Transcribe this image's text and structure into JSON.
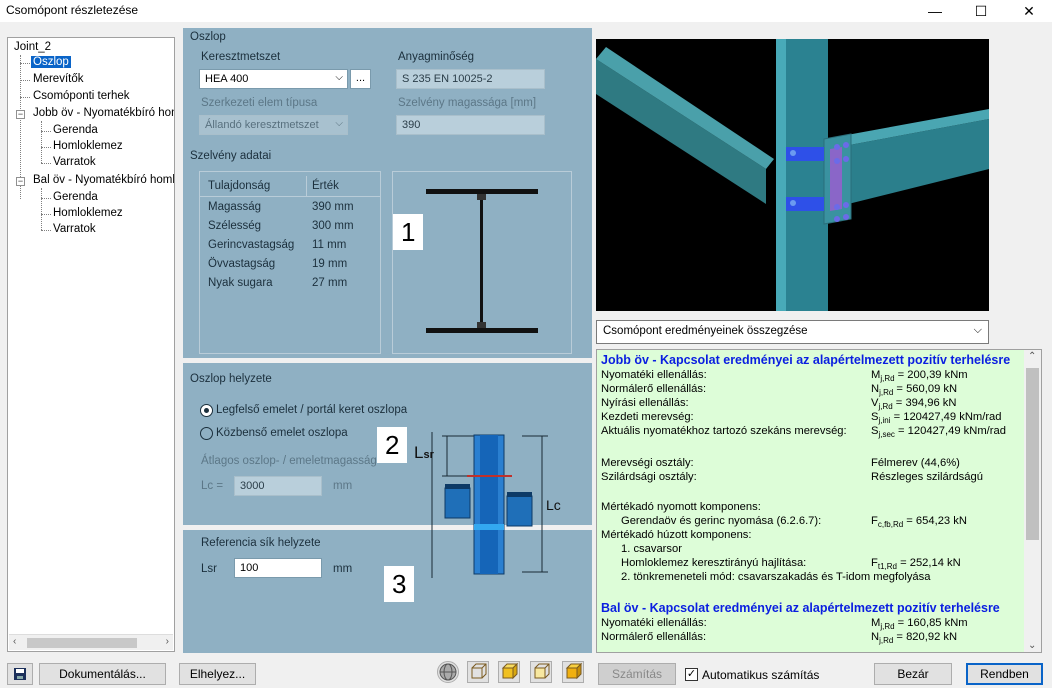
{
  "window": {
    "title": "Csomópont részletezése",
    "minimize": "—",
    "maximize": "☐",
    "close": "✕"
  },
  "tree": {
    "root": "Joint_2",
    "items": [
      "Oszlop",
      "Merevítők",
      "Csomóponti terhek",
      "Jobb öv - Nyomatékbíró homl",
      "Gerenda",
      "Homloklemez",
      "Varratok",
      "Bal öv - Nyomatékbíró homlc",
      "Gerenda",
      "Homloklemez",
      "Varratok"
    ],
    "selected": "Oszlop"
  },
  "oszlop": {
    "group_label": "Oszlop",
    "cross_section_label": "Keresztmetszet",
    "cross_section_value": "HEA 400",
    "browse_label": "...",
    "material_label": "Anyagminőség",
    "material_value": "S 235 EN 10025-2",
    "element_type_label": "Szerkezeti elem típusa",
    "element_type_value": "Állandó keresztmetszet",
    "height_label": "Szelvény magassága [mm]",
    "height_value": "390"
  },
  "section_data": {
    "group_label": "Szelvény adatai",
    "col_property": "Tulajdonság",
    "col_value": "Érték",
    "rows": [
      {
        "name": "Magasság",
        "value": "390 mm"
      },
      {
        "name": "Szélesség",
        "value": "300 mm"
      },
      {
        "name": "Gerincvastagság",
        "value": "11 mm"
      },
      {
        "name": "Övvastagság",
        "value": "19 mm"
      },
      {
        "name": "Nyak sugara",
        "value": "27 mm"
      }
    ]
  },
  "position": {
    "group_label": "Oszlop helyzete",
    "radio_top": "Legfelső emelet / portál keret oszlopa",
    "radio_mid": "Közbenső emelet oszlopa",
    "avg_height_label": "Átlagos oszlop- / emeletmagasság",
    "lc_label": "Lc =",
    "lc_value": "3000",
    "lc_unit": "mm",
    "lsr_diagram_label": "L",
    "lsr_diagram_sub": "sr",
    "lc_diagram_label": "Lc"
  },
  "reference": {
    "group_label": "Referencia sík helyzete",
    "lsr_label": "Lsr",
    "lsr_value": "100",
    "lsr_unit": "mm"
  },
  "markers": [
    "1",
    "2",
    "3"
  ],
  "summary_combo": "Csomópont eredményeinek összegzése",
  "results": {
    "right_header": "Jobb öv - Kapcsolat eredményei az alapértelmezett pozitív terhelésre",
    "right_rows": [
      {
        "label": "Nyomatéki ellenállás:",
        "sym": "M",
        "sub": "j,Rd",
        "val": " = 200,39 kNm"
      },
      {
        "label": "Normálerő ellenállás:",
        "sym": "N",
        "sub": "j,Rd",
        "val": " = 560,09 kN"
      },
      {
        "label": "Nyírási ellenállás:",
        "sym": "V",
        "sub": "j,Rd",
        "val": " = 394,96 kN"
      },
      {
        "label": "Kezdeti merevség:",
        "sym": "S",
        "sub": "j,ini",
        "val": " = 120427,49 kNm/rad"
      },
      {
        "label": "Aktuális nyomatékhoz tartozó szekáns merevség:",
        "sym": "S",
        "sub": "j,sec",
        "val": " = 120427,49 kNm/rad"
      }
    ],
    "stiffness_label": "Merevségi osztály:",
    "stiffness_value": "Félmerev (44,6%)",
    "strength_label": "Szilárdsági osztály:",
    "strength_value": "Részleges szilárdságú",
    "comp_label": "Mértékadó nyomott komponens:",
    "comp_item": "Gerendaöv és gerinc nyomása (6.2.6.7):",
    "comp_value_sym": "F",
    "comp_value_sub": "c,fb,Rd",
    "comp_value": " = 654,23 kN",
    "tens_label": "Mértékadó húzott komponens:",
    "tens_row1": "1. csavarsor",
    "tens_item": "Homloklemez keresztirányú hajlítása:",
    "tens_value_sym": "F",
    "tens_value_sub": "t1,Rd",
    "tens_value": " = 252,14 kN",
    "tens_mode": "2. tönkremeneteli mód: csavarszakadás és T-idom megfolyása",
    "left_header": "Bal öv - Kapcsolat eredményei az alapértelmezett pozitív terhelésre",
    "left_rows": [
      {
        "label": "Nyomatéki ellenállás:",
        "sym": "M",
        "sub": "j,Rd",
        "val": " = 160,85 kNm"
      },
      {
        "label": "Normálerő ellenállás:",
        "sym": "N",
        "sub": "j,Rd",
        "val": " = 820,92 kN"
      }
    ]
  },
  "footer": {
    "doc_button": "Dokumentálás...",
    "place_button": "Elhelyez...",
    "calc_button": "Számítás",
    "auto_calc": "Automatikus számítás",
    "close_button": "Bezár",
    "ok_button": "Rendben"
  }
}
